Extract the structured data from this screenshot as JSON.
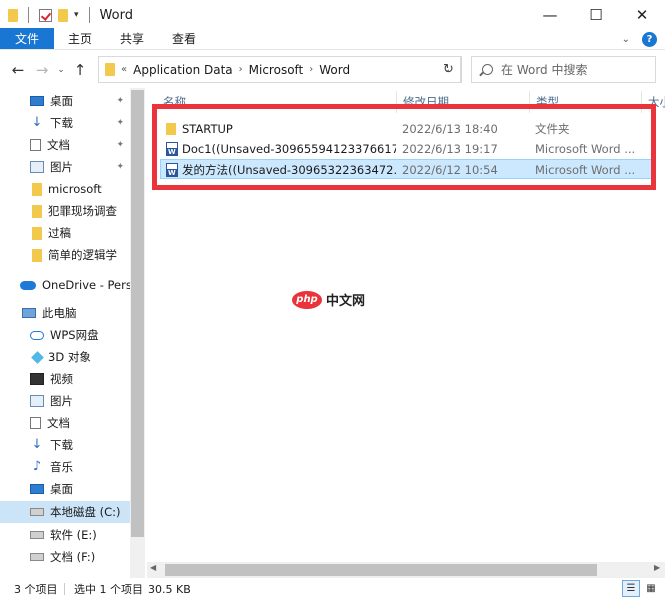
{
  "window": {
    "title": "Word",
    "minimize": "—",
    "maximize": "☐",
    "close": "✕"
  },
  "ribbon": {
    "tabs": [
      "文件",
      "主页",
      "共享",
      "查看"
    ],
    "help": "?",
    "collapse": "⌄"
  },
  "address": {
    "back": "←",
    "forward": "→",
    "recent": "⌄",
    "up": "↑",
    "overflow": "«",
    "crumbs": [
      "Application Data",
      "Microsoft",
      "Word"
    ],
    "search_placeholder": "在 Word 中搜索",
    "refresh": "↻"
  },
  "nav": {
    "items": [
      {
        "label": "桌面",
        "icon": "desktop-icon",
        "pinned": true
      },
      {
        "label": "下载",
        "icon": "download-icon",
        "pinned": true
      },
      {
        "label": "文档",
        "icon": "document-icon",
        "pinned": true
      },
      {
        "label": "图片",
        "icon": "pictures-icon",
        "pinned": true
      },
      {
        "label": "microsoft",
        "icon": "folder-icon",
        "pinned": false
      },
      {
        "label": "犯罪现场调查",
        "icon": "folder-icon",
        "pinned": false
      },
      {
        "label": "过稿",
        "icon": "folder-icon",
        "pinned": false
      },
      {
        "label": "简单的逻辑学",
        "icon": "folder-icon",
        "pinned": false
      },
      {
        "label": "OneDrive - Perso",
        "icon": "onedrive-icon",
        "pinned": false
      },
      {
        "label": "此电脑",
        "icon": "this-pc-icon",
        "pinned": false
      },
      {
        "label": "WPS网盘",
        "icon": "wps-cloud-icon",
        "pinned": false
      },
      {
        "label": "3D 对象",
        "icon": "3d-objects-icon",
        "pinned": false
      },
      {
        "label": "视频",
        "icon": "videos-icon",
        "pinned": false
      },
      {
        "label": "图片",
        "icon": "pictures-icon",
        "pinned": false
      },
      {
        "label": "文档",
        "icon": "document-icon",
        "pinned": false
      },
      {
        "label": "下载",
        "icon": "download-icon",
        "pinned": false
      },
      {
        "label": "音乐",
        "icon": "music-icon",
        "pinned": false
      },
      {
        "label": "桌面",
        "icon": "desktop-icon",
        "pinned": false
      },
      {
        "label": "本地磁盘 (C:)",
        "icon": "drive-icon",
        "pinned": false
      },
      {
        "label": "软件 (E:)",
        "icon": "drive-icon",
        "pinned": false
      },
      {
        "label": "文档 (F:)",
        "icon": "drive-icon",
        "pinned": false
      }
    ],
    "pin_glyph": "📌"
  },
  "columns": [
    "名称",
    "修改日期",
    "类型",
    "大小"
  ],
  "files": [
    {
      "name": "STARTUP",
      "date": "2022/6/13 18:40",
      "type": "文件夹",
      "kind": "folder"
    },
    {
      "name": "Doc1((Unsaved-30965594123376617...",
      "date": "2022/6/13 19:17",
      "type": "Microsoft Word ...",
      "kind": "word"
    },
    {
      "name": "发的方法((Unsaved-30965322363472...",
      "date": "2022/6/12 10:54",
      "type": "Microsoft Word ...",
      "kind": "word",
      "selected": true
    }
  ],
  "watermark": {
    "logo": "php",
    "text": "中文网"
  },
  "status": {
    "count": "3 个项目",
    "selected": "选中 1 个项目",
    "size": "30.5 KB"
  },
  "colors": {
    "accent": "#1976d2",
    "highlight_border": "#e8343a",
    "selection": "#cce8ff",
    "folder": "#f2c94c"
  }
}
